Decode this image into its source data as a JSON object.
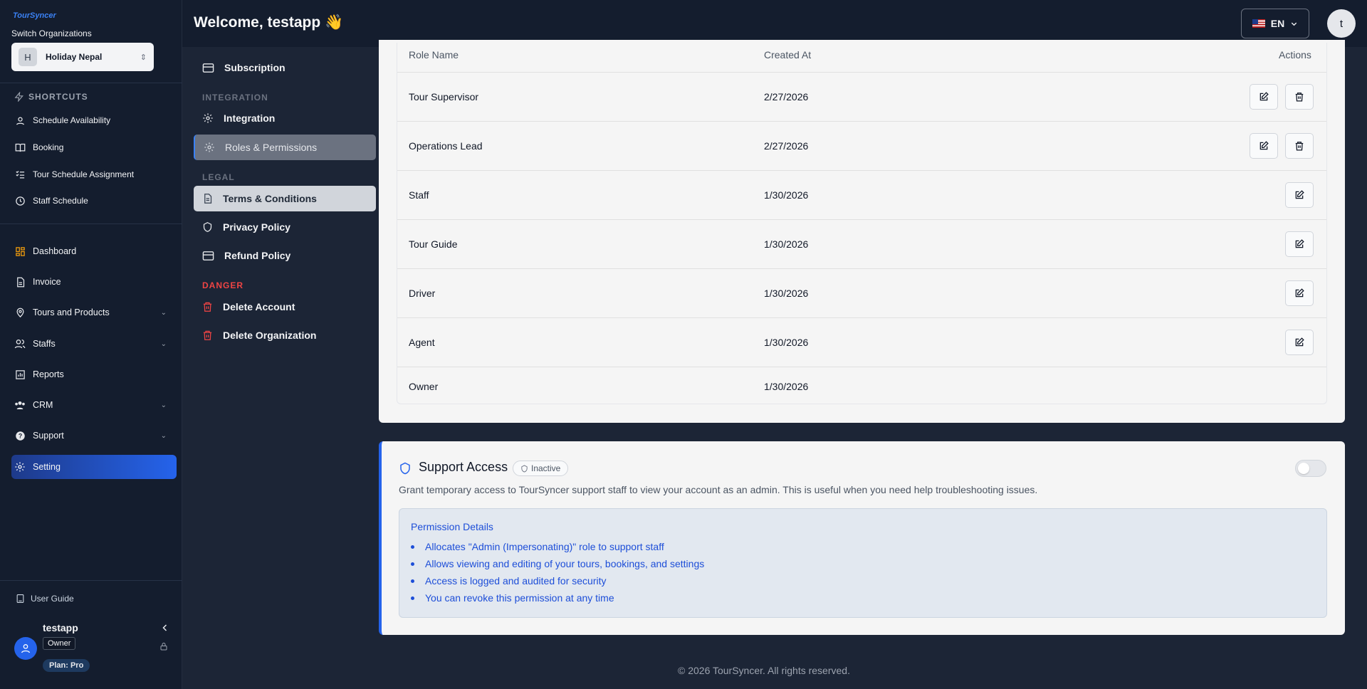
{
  "sidebar": {
    "logo": "TourSyncer",
    "switch_label": "Switch Organizations",
    "org": {
      "initial": "H",
      "name": "Holiday Nepal"
    },
    "shortcuts_title": "SHORTCUTS",
    "shortcuts": [
      {
        "label": "Schedule Availability",
        "icon": "map-pin-icon"
      },
      {
        "label": "Booking",
        "icon": "book-icon"
      },
      {
        "label": "Tour Schedule Assignment",
        "icon": "list-check-icon"
      },
      {
        "label": "Staff Schedule",
        "icon": "clock-icon"
      }
    ],
    "nav": [
      {
        "label": "Dashboard",
        "icon": "dashboard-icon"
      },
      {
        "label": "Invoice",
        "icon": "document-icon"
      },
      {
        "label": "Tours and Products",
        "icon": "map-pin-icon",
        "expandable": true
      },
      {
        "label": "Staffs",
        "icon": "users-icon",
        "expandable": true
      },
      {
        "label": "Reports",
        "icon": "chart-icon"
      },
      {
        "label": "CRM",
        "icon": "group-icon",
        "expandable": true
      },
      {
        "label": "Support",
        "icon": "help-icon",
        "expandable": true
      },
      {
        "label": "Setting",
        "icon": "gear-icon",
        "active": true
      }
    ],
    "user_guide": "User Guide",
    "user": {
      "name": "testapp",
      "role": "Owner",
      "plan": "Plan: Pro"
    }
  },
  "header": {
    "welcome": "Welcome, testapp 👋",
    "lang": "EN",
    "user_initial": "t"
  },
  "settings_nav": {
    "subscription": "Subscription",
    "section_integration": "INTEGRATION",
    "integration": "Integration",
    "roles": "Roles & Permissions",
    "section_legal": "LEGAL",
    "terms": "Terms & Conditions",
    "privacy": "Privacy Policy",
    "refund": "Refund Policy",
    "section_danger": "DANGER",
    "delete_account": "Delete Account",
    "delete_org": "Delete Organization"
  },
  "roles_table": {
    "columns": [
      "Role Name",
      "Created At",
      "Actions"
    ],
    "rows": [
      {
        "name": "Tour Supervisor",
        "created": "2/27/2026",
        "edit": true,
        "delete": true
      },
      {
        "name": "Operations Lead",
        "created": "2/27/2026",
        "edit": true,
        "delete": true
      },
      {
        "name": "Staff",
        "created": "1/30/2026",
        "edit": true,
        "delete": false
      },
      {
        "name": "Tour Guide",
        "created": "1/30/2026",
        "edit": true,
        "delete": false
      },
      {
        "name": "Driver",
        "created": "1/30/2026",
        "edit": true,
        "delete": false
      },
      {
        "name": "Agent",
        "created": "1/30/2026",
        "edit": true,
        "delete": false
      },
      {
        "name": "Owner",
        "created": "1/30/2026",
        "edit": false,
        "delete": false
      }
    ]
  },
  "support_access": {
    "title": "Support Access",
    "status": "Inactive",
    "enabled": false,
    "description": "Grant temporary access to TourSyncer support staff to view your account as an admin. This is useful when you need help troubleshooting issues.",
    "details_title": "Permission Details",
    "details": [
      "Allocates \"Admin (Impersonating)\" role to support staff",
      "Allows viewing and editing of your tours, bookings, and settings",
      "Access is logged and audited for security",
      "You can revoke this permission at any time"
    ]
  },
  "footer": "© 2026 TourSyncer. All rights reserved.",
  "colors": {
    "accent": "#2563eb",
    "danger": "#ef4444",
    "bg": "#1c2536",
    "sidebar": "#141d2e"
  }
}
